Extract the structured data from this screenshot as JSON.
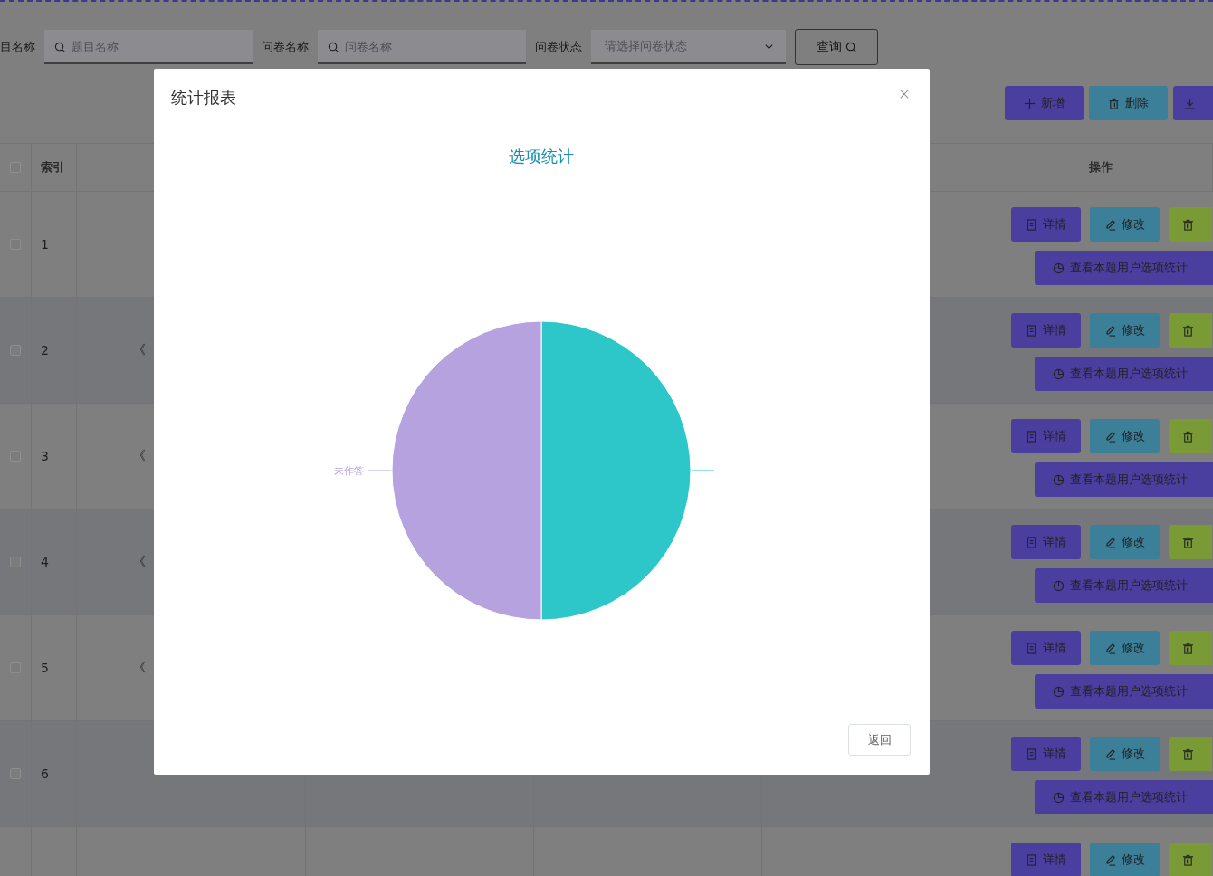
{
  "filters": [
    {
      "kind": "input",
      "label": "目名称",
      "placeholder": "题目名称"
    },
    {
      "kind": "input",
      "label": "问卷名称",
      "placeholder": "问卷名称"
    },
    {
      "kind": "select",
      "label": "问卷状态",
      "placeholder": "请选择问卷状态"
    }
  ],
  "query_button": "查询",
  "toolbar": [
    {
      "kind": "add",
      "label": "新增"
    },
    {
      "kind": "delete",
      "label": "删除"
    },
    {
      "kind": "export"
    }
  ],
  "table": {
    "select_all_checked": false,
    "index_heading": "索引",
    "actions_heading": "操作",
    "rows": [
      {
        "checked": false,
        "index": "1",
        "cells": [],
        "actions": [
          {
            "kind": "details",
            "label": "详情"
          },
          {
            "kind": "edit",
            "label": "修改"
          },
          {
            "kind": "delete"
          }
        ],
        "stats_button": "查看本题用户选项统计"
      },
      {
        "checked": false,
        "index": "2",
        "cells": [
          "《"
        ],
        "actions": [
          {
            "kind": "details",
            "label": "详情"
          },
          {
            "kind": "edit",
            "label": "修改"
          },
          {
            "kind": "delete"
          }
        ],
        "stats_button": "查看本题用户选项统计"
      },
      {
        "checked": false,
        "index": "3",
        "cells": [
          "《"
        ],
        "actions": [
          {
            "kind": "details",
            "label": "详情"
          },
          {
            "kind": "edit",
            "label": "修改"
          },
          {
            "kind": "delete"
          }
        ],
        "stats_button": "查看本题用户选项统计"
      },
      {
        "checked": false,
        "index": "4",
        "cells": [
          "《"
        ],
        "actions": [
          {
            "kind": "details",
            "label": "详情"
          },
          {
            "kind": "edit",
            "label": "修改"
          },
          {
            "kind": "delete"
          }
        ],
        "stats_button": "查看本题用户选项统计"
      },
      {
        "checked": false,
        "index": "5",
        "cells": [
          "《"
        ],
        "actions": [
          {
            "kind": "details",
            "label": "详情"
          },
          {
            "kind": "edit",
            "label": "修改"
          },
          {
            "kind": "delete"
          }
        ],
        "stats_button": "查看本题用户选项统计"
      },
      {
        "checked": false,
        "index": "6",
        "cells": [],
        "actions": [
          {
            "kind": "details",
            "label": "详情"
          },
          {
            "kind": "edit",
            "label": "修改"
          },
          {
            "kind": "delete"
          }
        ],
        "stats_button": "查看本题用户选项统计"
      },
      {
        "actions": [
          {
            "kind": "details",
            "label": "详情"
          },
          {
            "kind": "edit",
            "label": "修改"
          },
          {
            "kind": "delete"
          }
        ]
      }
    ]
  },
  "dialog": {
    "title": "统计报表",
    "chart_data": {
      "type": "pie",
      "title": "选项统计",
      "categories": [
        null,
        "未作答"
      ],
      "values": [
        50,
        50
      ]
    },
    "back_button": "返回"
  }
}
